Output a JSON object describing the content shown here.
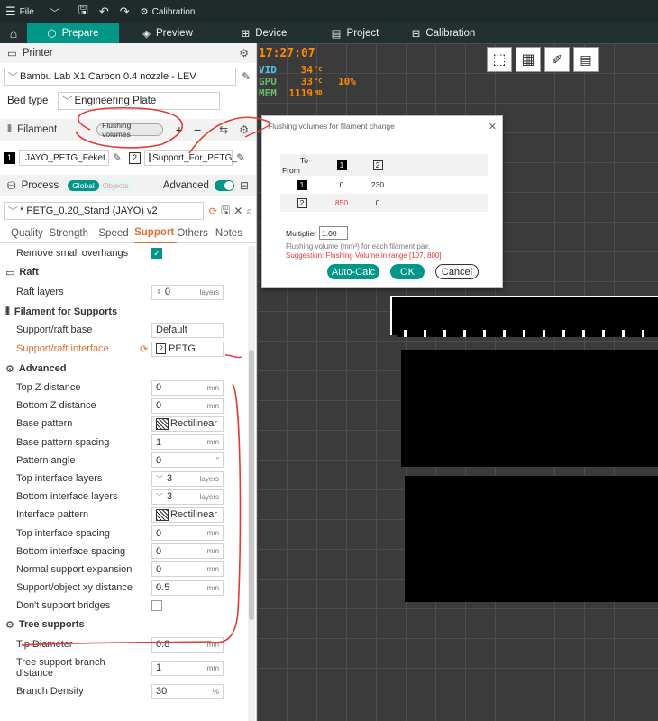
{
  "topbar": {
    "file_label": "File",
    "calibration_label": "Calibration"
  },
  "tabs": [
    {
      "label": "Prepare",
      "icon": "cube-icon"
    },
    {
      "label": "Preview",
      "icon": "layers-icon"
    },
    {
      "label": "Device",
      "icon": "device-icon"
    },
    {
      "label": "Project",
      "icon": "project-icon"
    },
    {
      "label": "Calibration",
      "icon": "calibration-icon"
    }
  ],
  "printer": {
    "section_label": "Printer",
    "model": "Bambu Lab X1 Carbon 0.4 nozzle - LEV",
    "bed_type_label": "Bed type",
    "bed_type_value": "Engineering Plate"
  },
  "filament": {
    "section_label": "Filament",
    "flushing_button": "Flushing volumes",
    "slots": [
      {
        "index": "1",
        "name": "JAYO_PETG_Feket...",
        "color": "#000000"
      },
      {
        "index": "2",
        "name": "Support_For_PETG_...",
        "color": "#ffffff"
      }
    ]
  },
  "process": {
    "section_label": "Process",
    "global_label": "Global",
    "objects_label": "Objects",
    "advanced_label": "Advanced",
    "preset": "* PETG_0.20_Stand (JAYO) v2",
    "tabs": [
      "Quality",
      "Strength",
      "Speed",
      "Support",
      "Others",
      "Notes"
    ],
    "active_tab": "Support"
  },
  "settings": {
    "remove_small_overhangs": "Remove small overhangs",
    "raft_group": "Raft",
    "raft_layers_label": "Raft layers",
    "raft_layers_value": "0",
    "raft_layers_unit": "layers",
    "filament_support_group": "Filament for Supports",
    "support_base_label": "Support/raft base",
    "support_base_value": "Default",
    "support_interface_label": "Support/raft interface",
    "support_interface_value": "PETG",
    "support_interface_index": "2",
    "advanced_group": "Advanced",
    "advanced_rows": [
      {
        "label": "Top Z distance",
        "value": "0",
        "unit": "mm"
      },
      {
        "label": "Bottom Z distance",
        "value": "0",
        "unit": "mm"
      },
      {
        "label": "Base pattern",
        "value": "Rectilinear",
        "unit": ""
      },
      {
        "label": "Base pattern spacing",
        "value": "1",
        "unit": "mm"
      },
      {
        "label": "Pattern angle",
        "value": "0",
        "unit": "°"
      },
      {
        "label": "Top interface layers",
        "value": "3",
        "unit": "layers"
      },
      {
        "label": "Bottom interface layers",
        "value": "3",
        "unit": "layers"
      },
      {
        "label": "Interface pattern",
        "value": "Rectilinear",
        "unit": ""
      },
      {
        "label": "Top interface spacing",
        "value": "0",
        "unit": "mm"
      },
      {
        "label": "Bottom interface spacing",
        "value": "0",
        "unit": "mm"
      },
      {
        "label": "Normal support expansion",
        "value": "0",
        "unit": "mm"
      },
      {
        "label": "Support/object xy distance",
        "value": "0.5",
        "unit": "mm"
      }
    ],
    "dont_support_bridges": "Don't support bridges",
    "tree_group": "Tree supports",
    "tip_diameter_label": "Tip Diameter",
    "tip_diameter_value": "0.8",
    "tip_diameter_unit": "mm",
    "branch_distance_label": "Tree support branch distance",
    "branch_distance_value": "1",
    "branch_distance_unit": "mm",
    "branch_density_label": "Branch Density",
    "branch_density_value": "30",
    "branch_density_unit": "%"
  },
  "overlay": {
    "clock": "17:27:07",
    "stats": [
      {
        "name": "VID",
        "value": "34",
        "unit": "°C",
        "extra": ""
      },
      {
        "name": "GPU",
        "value": "33",
        "unit": "°C",
        "extra": "10%"
      },
      {
        "name": "MEM",
        "value": "1119",
        "unit": "MB",
        "extra": ""
      }
    ]
  },
  "dialog": {
    "title": "Flushing volumes for filament change",
    "to_label": "To",
    "from_label": "From",
    "col_headers": [
      "1",
      "2"
    ],
    "rows": [
      {
        "from": "1",
        "values": [
          "0",
          "230"
        ]
      },
      {
        "from": "2",
        "values": [
          "850",
          "0"
        ]
      }
    ],
    "multiplier_label": "Multiplier",
    "multiplier_value": "1.00",
    "note": "Flushing volume (mm³) for each filament pair.",
    "suggestion": "Suggestion: Flushing Volume in range [107, 800]",
    "auto_calc": "Auto-Calc",
    "ok": "OK",
    "cancel": "Cancel"
  }
}
